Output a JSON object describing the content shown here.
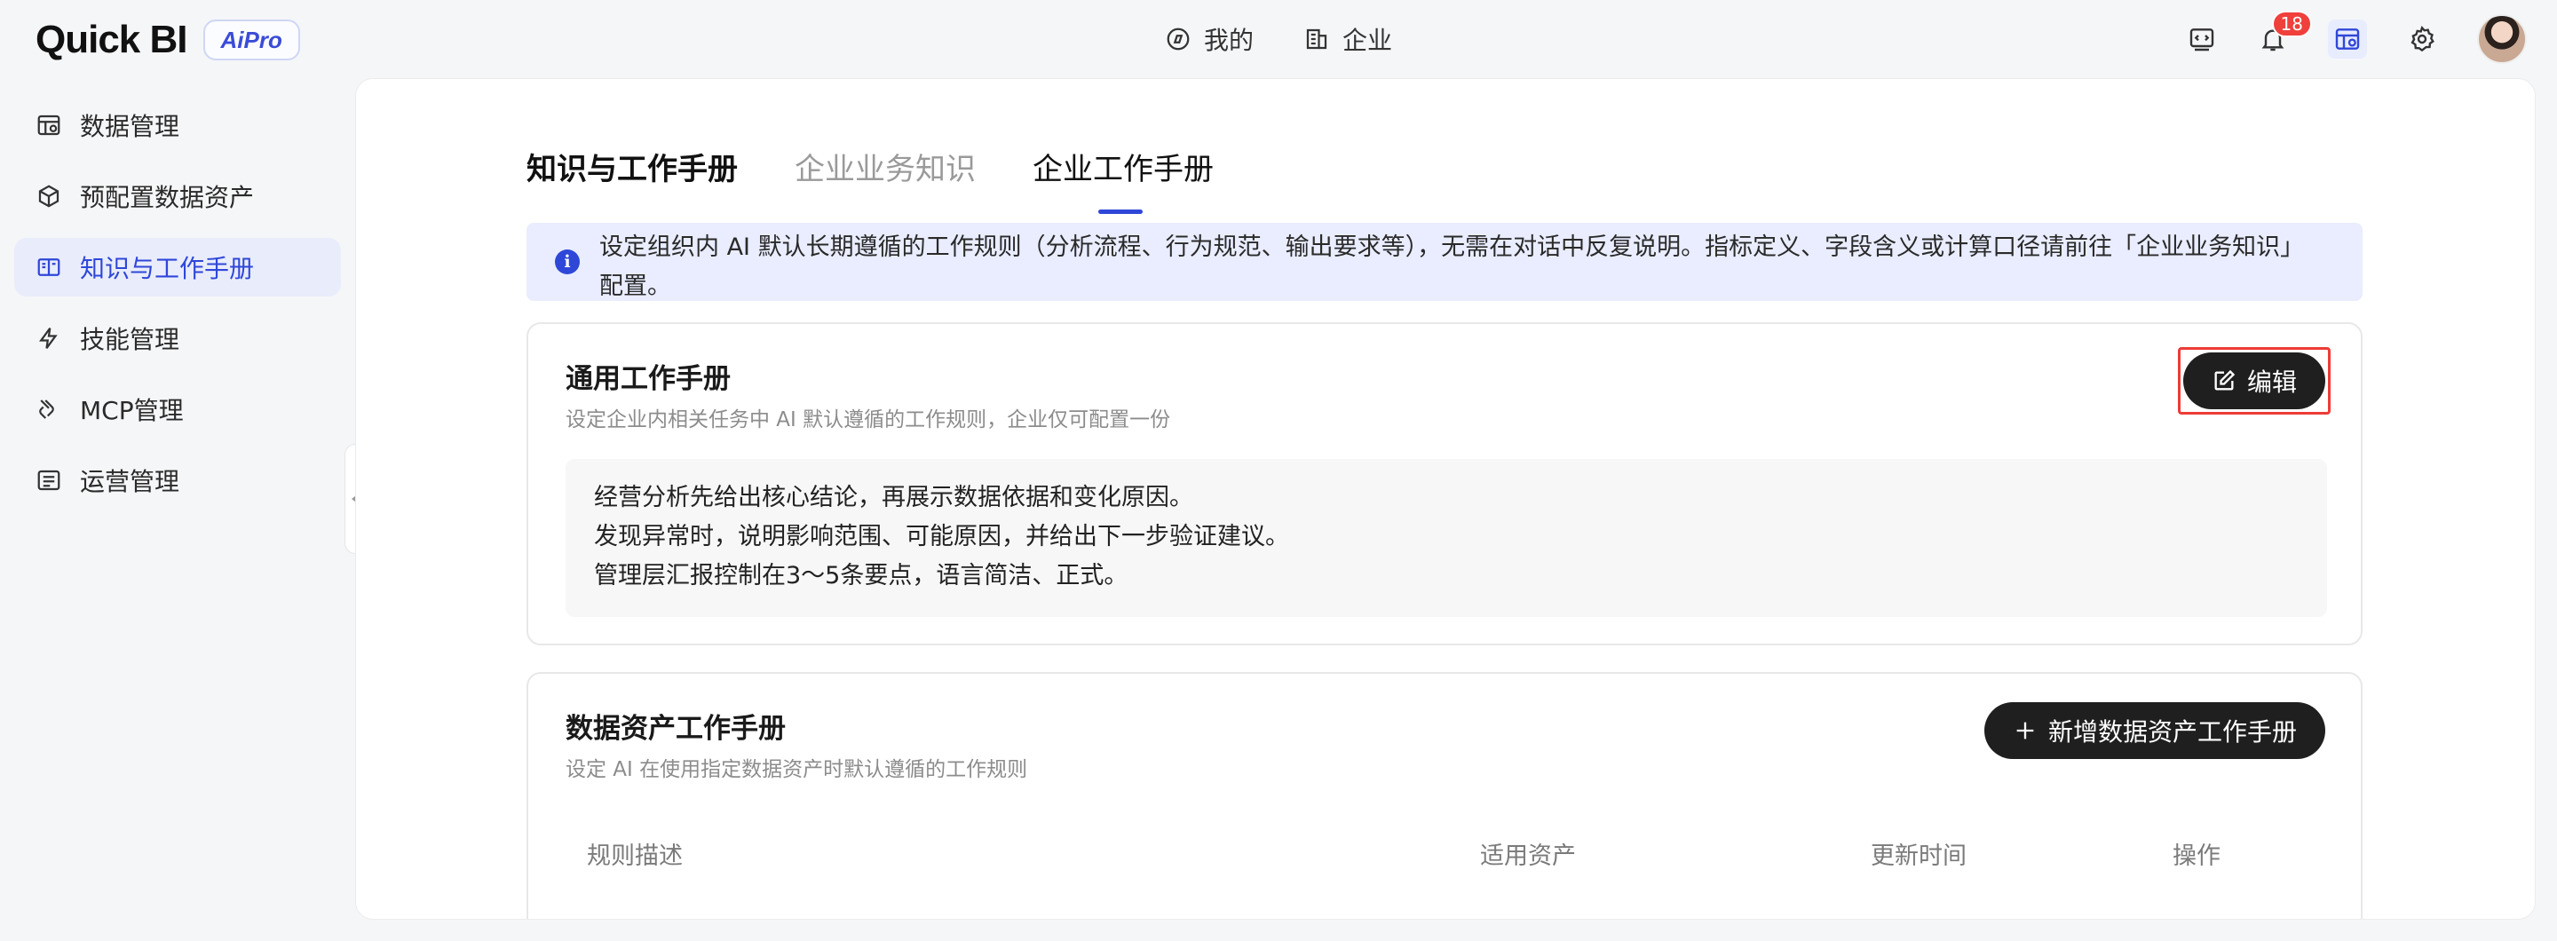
{
  "app": {
    "logo_text": "Quick BI",
    "logo_badge": "AiPro"
  },
  "top_nav": [
    {
      "label": "我的",
      "icon": "compass-icon"
    },
    {
      "label": "企业",
      "icon": "building-icon"
    }
  ],
  "header_actions": {
    "notification_count": "18"
  },
  "sidebar": {
    "items": [
      {
        "label": "数据管理",
        "icon": "data-table-icon",
        "active": false
      },
      {
        "label": "预配置数据资产",
        "icon": "cube-icon",
        "active": false
      },
      {
        "label": "知识与工作手册",
        "icon": "book-icon",
        "active": true
      },
      {
        "label": "技能管理",
        "icon": "lightning-icon",
        "active": false
      },
      {
        "label": "MCP管理",
        "icon": "mcp-icon",
        "active": false
      },
      {
        "label": "运营管理",
        "icon": "list-icon",
        "active": false
      }
    ]
  },
  "main": {
    "tabs": [
      {
        "label": "知识与工作手册"
      },
      {
        "label": "企业业务知识"
      },
      {
        "label": "企业工作手册"
      }
    ],
    "notice": "设定组织内 AI 默认长期遵循的工作规则（分析流程、行为规范、输出要求等），无需在对话中反复说明。指标定义、字段含义或计算口径请前往「企业业务知识」配置。",
    "general": {
      "title": "通用工作手册",
      "desc": "设定企业内相关任务中 AI 默认遵循的工作规则，企业仅可配置一份",
      "edit_label": "编辑",
      "rules": [
        "经营分析先给出核心结论，再展示数据依据和变化原因。",
        "发现异常时，说明影响范围、可能原因，并给出下一步验证建议。",
        "管理层汇报控制在3～5条要点，语言简洁、正式。"
      ]
    },
    "data_asset": {
      "title": "数据资产工作手册",
      "desc": "设定 AI 在使用指定数据资产时默认遵循的工作规则",
      "add_label": "新增数据资产工作手册",
      "columns": [
        "规则描述",
        "适用资产",
        "更新时间",
        "操作"
      ]
    }
  }
}
